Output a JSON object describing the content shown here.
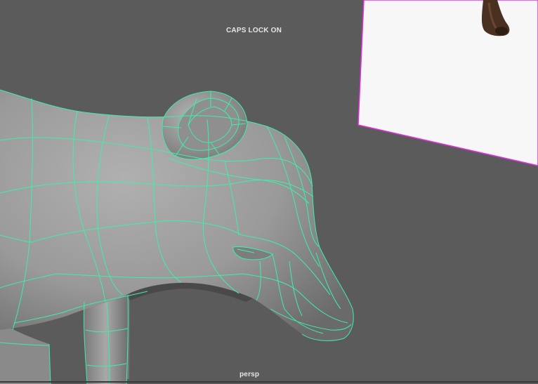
{
  "viewport": {
    "caps_lock_indicator": "CAPS LOCK ON",
    "camera_label": "persp",
    "background_color": "#5b5b5b",
    "wireframe_color": "#3cf0a8",
    "image_plane_border_color": "#e030e0"
  },
  "scene": {
    "model": "dog-head-polygon-mesh",
    "image_plane": "reference-image-plane"
  }
}
